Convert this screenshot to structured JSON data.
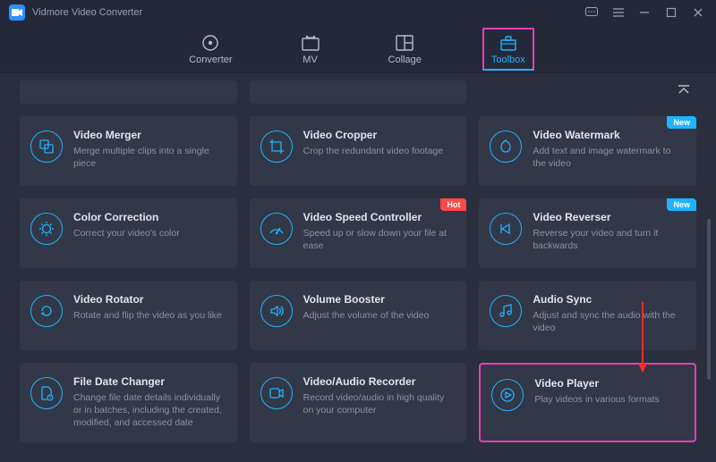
{
  "app": {
    "title": "Vidmore Video Converter"
  },
  "tabs": {
    "converter": "Converter",
    "mv": "MV",
    "collage": "Collage",
    "toolbox": "Toolbox"
  },
  "badges": {
    "hot": "Hot",
    "new": "New"
  },
  "cards": {
    "merger": {
      "title": "Video Merger",
      "desc": "Merge multiple clips into a single piece"
    },
    "cropper": {
      "title": "Video Cropper",
      "desc": "Crop the redundant video footage"
    },
    "watermark": {
      "title": "Video Watermark",
      "desc": "Add text and image watermark to the video"
    },
    "color": {
      "title": "Color Correction",
      "desc": "Correct your video's color"
    },
    "speed": {
      "title": "Video Speed Controller",
      "desc": "Speed up or slow down your file at ease"
    },
    "reverser": {
      "title": "Video Reverser",
      "desc": "Reverse your video and turn it backwards"
    },
    "rotator": {
      "title": "Video Rotator",
      "desc": "Rotate and flip the video as you like"
    },
    "volume": {
      "title": "Volume Booster",
      "desc": "Adjust the volume of the video"
    },
    "audiosync": {
      "title": "Audio Sync",
      "desc": "Adjust and sync the audio with the video"
    },
    "filedate": {
      "title": "File Date Changer",
      "desc": "Change file date details individually or in batches, including the created, modified, and accessed date"
    },
    "recorder": {
      "title": "Video/Audio Recorder",
      "desc": "Record video/audio in high quality on your computer"
    },
    "player": {
      "title": "Video Player",
      "desc": "Play videos in various formats"
    }
  }
}
